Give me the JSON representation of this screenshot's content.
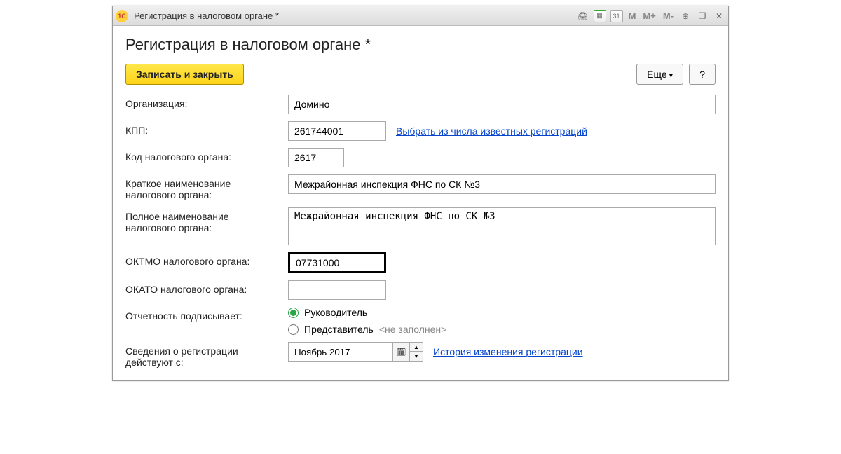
{
  "titlebar": {
    "title": "Регистрация в налоговом органе *",
    "app_icon_text": "1С"
  },
  "page_title": "Регистрация в налоговом органе *",
  "toolbar": {
    "save_close": "Записать и закрыть",
    "more": "Еще",
    "help": "?"
  },
  "form": {
    "organization": {
      "label": "Организация:",
      "value": "Домино"
    },
    "kpp": {
      "label": "КПП:",
      "value": "261744001",
      "link": "Выбрать из числа известных регистраций"
    },
    "tax_code": {
      "label": "Код налогового органа:",
      "value": "2617"
    },
    "short_name": {
      "label": "Краткое наименование налогового органа:",
      "value": "Межрайонная инспекция ФНС по СК №3"
    },
    "full_name": {
      "label": "Полное наименование налогового органа:",
      "value": "Межрайонная инспекция ФНС по СК №3"
    },
    "oktmo": {
      "label": "ОКТМО налогового органа:",
      "value": "07731000"
    },
    "okato": {
      "label": "ОКАТО налогового органа:",
      "value": ""
    },
    "signer": {
      "label": "Отчетность подписывает:",
      "option1": "Руководитель",
      "option2": "Представитель",
      "hint": "<не заполнен>"
    },
    "effective": {
      "label": "Сведения о регистрации действуют с:",
      "value": "Ноябрь 2017",
      "link": "История изменения регистрации"
    }
  }
}
